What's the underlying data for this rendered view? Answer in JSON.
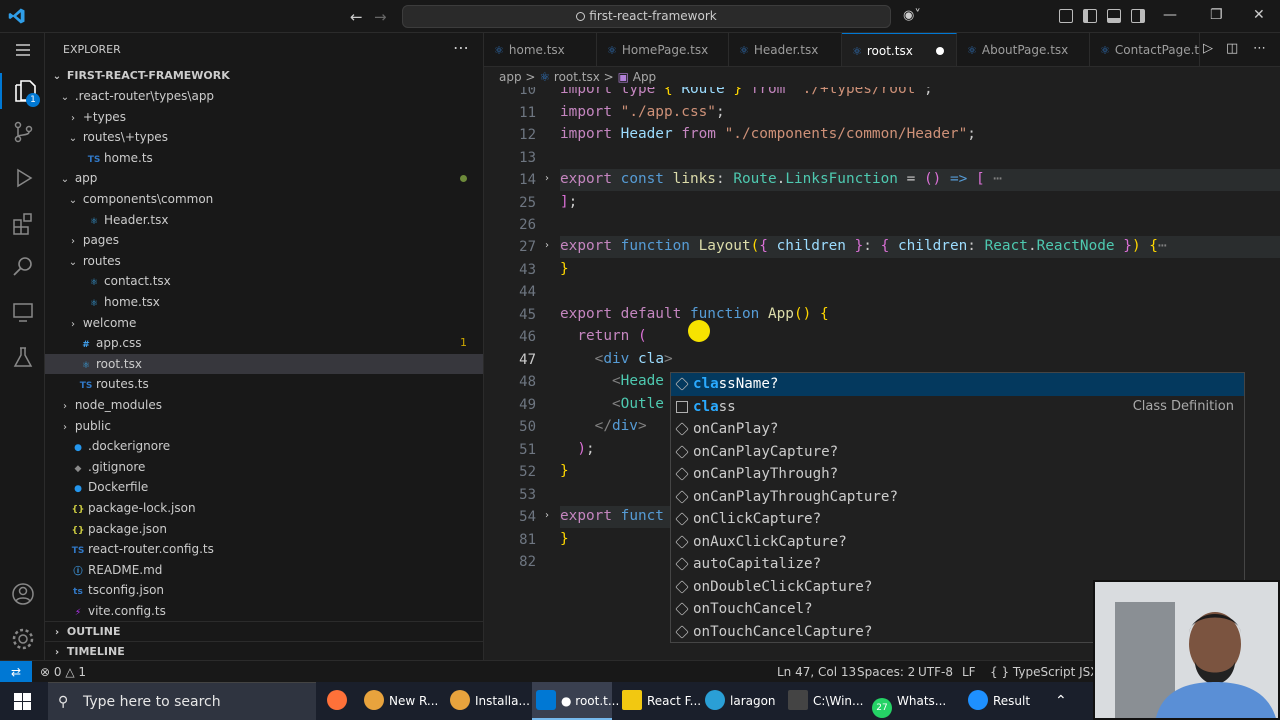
{
  "window": {
    "search_text": "first-react-framework"
  },
  "sidebar": {
    "header": "EXPLORER",
    "root": "FIRST-REACT-FRAMEWORK",
    "items": [
      {
        "label": ".react-router\\types\\app",
        "kind": "folder-open",
        "indent": 1
      },
      {
        "label": "+types",
        "kind": "folder",
        "indent": 2
      },
      {
        "label": "routes\\+types",
        "kind": "folder-open",
        "indent": 2
      },
      {
        "label": "home.ts",
        "kind": "ts",
        "indent": 3
      },
      {
        "label": "app",
        "kind": "folder-open",
        "indent": 1,
        "status": "dot"
      },
      {
        "label": "components\\common",
        "kind": "folder-open",
        "indent": 2
      },
      {
        "label": "Header.tsx",
        "kind": "react",
        "indent": 3
      },
      {
        "label": "pages",
        "kind": "folder",
        "indent": 2
      },
      {
        "label": "routes",
        "kind": "folder-open",
        "indent": 2
      },
      {
        "label": "contact.tsx",
        "kind": "react",
        "indent": 3
      },
      {
        "label": "home.tsx",
        "kind": "react",
        "indent": 3
      },
      {
        "label": "welcome",
        "kind": "folder",
        "indent": 2
      },
      {
        "label": "app.css",
        "kind": "css",
        "indent": 2,
        "status": "1"
      },
      {
        "label": "root.tsx",
        "kind": "react",
        "indent": 2,
        "selected": true
      },
      {
        "label": "routes.ts",
        "kind": "ts",
        "indent": 2
      },
      {
        "label": "node_modules",
        "kind": "folder",
        "indent": 1
      },
      {
        "label": "public",
        "kind": "folder",
        "indent": 1
      },
      {
        "label": ".dockerignore",
        "kind": "docker",
        "indent": 1
      },
      {
        "label": ".gitignore",
        "kind": "git",
        "indent": 1
      },
      {
        "label": "Dockerfile",
        "kind": "docker",
        "indent": 1
      },
      {
        "label": "package-lock.json",
        "kind": "json",
        "indent": 1
      },
      {
        "label": "package.json",
        "kind": "json",
        "indent": 1
      },
      {
        "label": "react-router.config.ts",
        "kind": "ts",
        "indent": 1
      },
      {
        "label": "README.md",
        "kind": "info",
        "indent": 1
      },
      {
        "label": "tsconfig.json",
        "kind": "tsconfig",
        "indent": 1
      },
      {
        "label": "vite.config.ts",
        "kind": "vite",
        "indent": 1
      }
    ],
    "outline": "OUTLINE",
    "timeline": "TIMELINE"
  },
  "activity": {
    "explorer_badge": "1"
  },
  "tabs": [
    {
      "label": "home.tsx"
    },
    {
      "label": "HomePage.tsx"
    },
    {
      "label": "Header.tsx"
    },
    {
      "label": "root.tsx",
      "active": true,
      "modified": true
    },
    {
      "label": "AboutPage.tsx"
    },
    {
      "label": "ContactPage.t"
    }
  ],
  "breadcrumb": {
    "a": "app",
    "b": "root.tsx",
    "c": "App",
    "sep": ">"
  },
  "editor": {
    "lines": [
      "10",
      "11",
      "12",
      "13",
      "14",
      "25",
      "26",
      "27",
      "43",
      "44",
      "45",
      "46",
      "47",
      "48",
      "49",
      "50",
      "51",
      "52",
      "53",
      "54",
      "81",
      "82"
    ],
    "current_line": "47"
  },
  "suggest": {
    "items": [
      {
        "label": "className?",
        "match": "cla",
        "selected": true
      },
      {
        "label": "class",
        "match": "cla",
        "detail": "Class Definition"
      },
      {
        "label": "onCanPlay?",
        "match": ""
      },
      {
        "label": "onCanPlayCapture?",
        "match": ""
      },
      {
        "label": "onCanPlayThrough?",
        "match": ""
      },
      {
        "label": "onCanPlayThroughCapture?",
        "match": ""
      },
      {
        "label": "onClickCapture?",
        "match": ""
      },
      {
        "label": "onAuxClickCapture?",
        "match": ""
      },
      {
        "label": "autoCapitalize?",
        "match": ""
      },
      {
        "label": "onDoubleClickCapture?",
        "match": ""
      },
      {
        "label": "onTouchCancel?",
        "match": ""
      },
      {
        "label": "onTouchCancelCapture?",
        "match": ""
      }
    ]
  },
  "status": {
    "errors": "0",
    "warnings": "1",
    "position": "Ln 47, Col 13",
    "spaces": "Spaces: 2",
    "encoding": "UTF-8",
    "eol": "LF",
    "language": "TypeScript JSX"
  },
  "taskbar": {
    "search_placeholder": "Type here to search",
    "items": [
      {
        "label": "New R...",
        "color": "#e8a33d"
      },
      {
        "label": "Installa...",
        "color": "#e8a33d"
      },
      {
        "label": "● root.t...",
        "color": "#0078d4"
      },
      {
        "label": "React F...",
        "color": "#f2c811"
      },
      {
        "label": "laragon",
        "color": "#2a9fd6"
      },
      {
        "label": "C:\\Win...",
        "color": "#444444"
      },
      {
        "label": "Whats...",
        "color": "#25d366"
      },
      {
        "label": "Result",
        "color": "#1e90ff"
      }
    ],
    "whatsapp_badge": "27"
  },
  "colors": {
    "accent": "#0078d4",
    "status_bg": "#181818",
    "editor_bg": "#1f1f1f"
  }
}
